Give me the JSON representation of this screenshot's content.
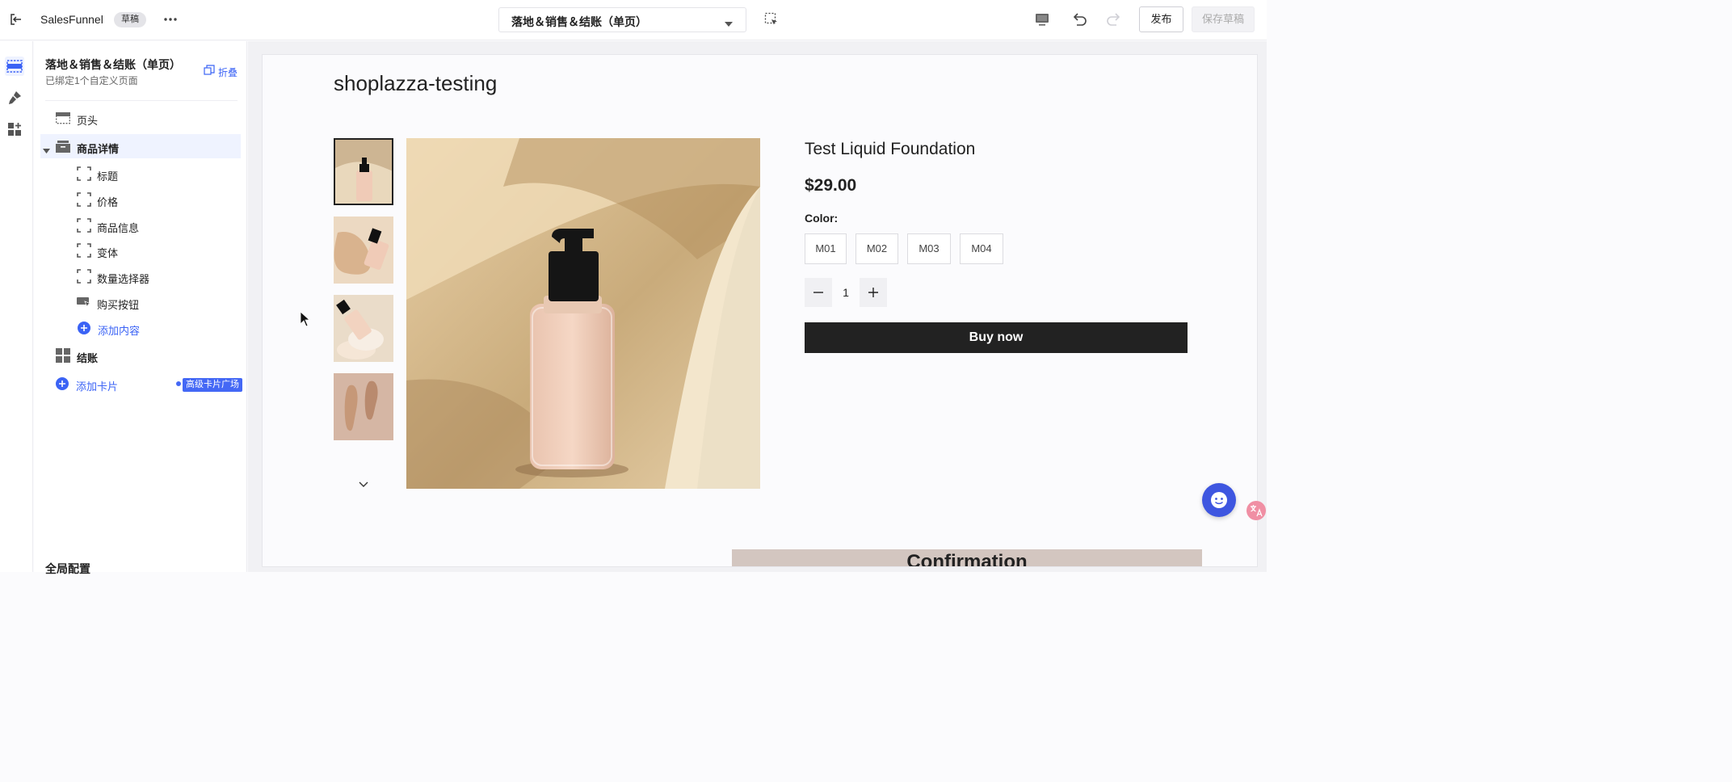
{
  "topbar": {
    "app_title": "SalesFunnel",
    "draft_badge": "草稿",
    "page_select_label": "落地＆销售＆结账（单页）",
    "publish_label": "发布",
    "save_draft_label": "保存草稿"
  },
  "panel": {
    "title": "落地＆销售＆结账（单页）",
    "subtitle": "已绑定1个自定义页面",
    "collapse_label": "折叠",
    "items": [
      {
        "label": "页头",
        "icon": "header-icon"
      },
      {
        "label": "商品详情",
        "icon": "product-icon",
        "expanded": true,
        "selected": true
      },
      {
        "label": "标题",
        "icon": "block-icon"
      },
      {
        "label": "价格",
        "icon": "block-icon"
      },
      {
        "label": "商品信息",
        "icon": "block-icon"
      },
      {
        "label": "变体",
        "icon": "block-icon"
      },
      {
        "label": "数量选择器",
        "icon": "block-icon"
      },
      {
        "label": "购买按钮",
        "icon": "buy-button-icon"
      },
      {
        "label": "添加内容",
        "icon": "add-circle-icon"
      },
      {
        "label": "结账",
        "icon": "grid-icon"
      },
      {
        "label": "添加卡片",
        "icon": "add-circle-icon"
      }
    ],
    "pro_tag": "高级卡片广场",
    "global_config": "全局配置"
  },
  "canvas": {
    "store_name": "shoplazza-testing",
    "product_title": "Test Liquid Foundation",
    "price": "$29.00",
    "color_label": "Color:",
    "variants": [
      "M01",
      "M02",
      "M03",
      "M04"
    ],
    "quantity": "1",
    "buy_now": "Buy now",
    "confirmation": "Confirmation"
  },
  "colors": {
    "accent": "#3b63f5",
    "buy_button": "#222222",
    "confirmation_bar": "#d3c6c0",
    "support_button": "#3e56e0"
  }
}
